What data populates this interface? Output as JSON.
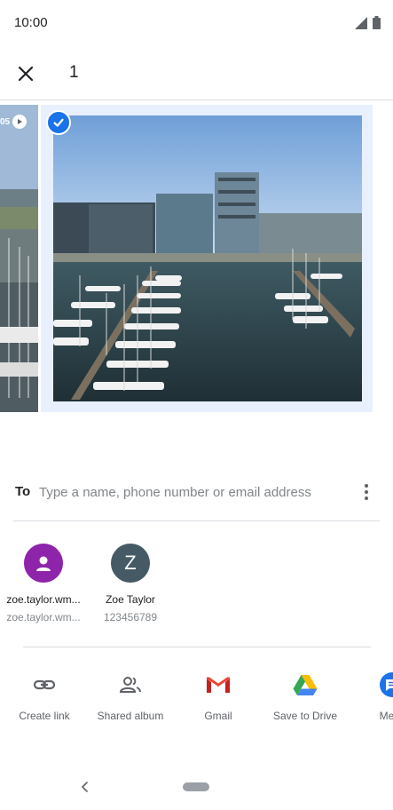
{
  "status_bar": {
    "time": "10:00",
    "icons": [
      "signal-icon",
      "battery-icon"
    ]
  },
  "top_bar": {
    "close_icon": "close-icon",
    "selected_count": "1"
  },
  "carousel": {
    "left_badge_text": "05",
    "selected_check_icon": "check-circle-icon"
  },
  "recipient": {
    "label": "To",
    "placeholder": "Type a name, phone number or email address",
    "more_icon": "more-vert-icon"
  },
  "contacts": [
    {
      "name": "zoe.taylor.wm...",
      "sub": "zoe.taylor.wm...",
      "avatar": "person-icon"
    },
    {
      "name": "Zoe Taylor",
      "sub": "123456789",
      "avatar_letter": "Z"
    }
  ],
  "apps": [
    {
      "label": "Create link",
      "icon": "link-icon"
    },
    {
      "label": "Shared album",
      "icon": "people-icon"
    },
    {
      "label": "Gmail",
      "icon": "gmail-icon"
    },
    {
      "label": "Save to Drive",
      "icon": "drive-icon"
    },
    {
      "label": "Mess",
      "icon": "messages-icon"
    }
  ],
  "colors": {
    "accent": "#1a73e8",
    "selected_bg": "#e8f0fe",
    "avatar_purple": "#8e24aa",
    "avatar_slate": "#455a64"
  }
}
